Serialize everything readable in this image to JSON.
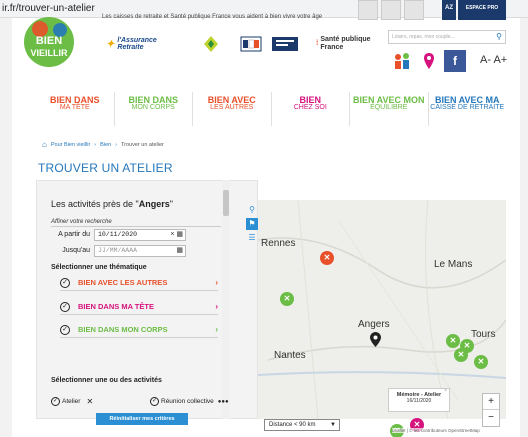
{
  "url": "ir.fr/trouver-un-atelier",
  "header": {
    "tagline": "Les caisses de retraite et Santé publique France vous aident à bien vivre votre âge",
    "logo_lines": [
      "BIEN",
      "VIEILLIR"
    ],
    "partners": {
      "assurance_retraite": "l'Assurance Retraite",
      "spf": "Santé publique France"
    },
    "az_label": "AZ",
    "espace_pro": "ESPACE PRO",
    "search_placeholder": "Loisirs, repas, mon couple...",
    "font_size_label": "A- A+"
  },
  "nav": [
    {
      "top": "BIEN DANS",
      "bottom": "MA TÊTE",
      "color": "#e8502a"
    },
    {
      "top": "BIEN DANS",
      "bottom": "MON CORPS",
      "color": "#6cbd45"
    },
    {
      "top": "BIEN AVEC",
      "bottom": "LES AUTRES",
      "color": "#e8502a"
    },
    {
      "top": "BIEN",
      "bottom": "CHEZ SOI",
      "color": "#d6127d"
    },
    {
      "top": "BIEN AVEC MON",
      "bottom": "ÉQUILIBRE",
      "color": "#6cbd45"
    },
    {
      "top": "BIEN AVEC MA",
      "bottom": "CAISSE DE RETRAITE",
      "color": "#2577bb"
    }
  ],
  "breadcrumb": {
    "home": "Pour Bien vieillir",
    "level1": "Bien",
    "current": "Trouver un atelier"
  },
  "page_title": "TROUVER UN ATELIER",
  "panel": {
    "title_prefix": "Les activités près de \"",
    "title_city": "Angers",
    "title_suffix": "\"",
    "refine": "Affiner votre recherche",
    "from_label": "A partir du",
    "from_value": "10/11/2020",
    "to_label": "Jusqu'au",
    "to_placeholder": "JJ/MM/AAAA",
    "theme_title": "Sélectionner une thématique",
    "themes": [
      {
        "label": "BIEN AVEC LES AUTRES",
        "color": "#e8502a"
      },
      {
        "label": "BIEN DANS MA TÊTE",
        "color": "#d6127d"
      },
      {
        "label": "BIEN DANS MON CORPS",
        "color": "#6cbd45"
      }
    ],
    "activities_title": "Sélectionner une ou des activités",
    "activity_atelier": "Atelier",
    "activity_reunion": "Réunion collective",
    "reset_label": "Réinitialiser mes critères"
  },
  "map": {
    "cities": [
      "Rennes",
      "Le Mans",
      "Angers",
      "Nantes",
      "Tours"
    ],
    "popup_title": "Mémoire - Atelier",
    "popup_date": "16/11/2020",
    "distance_label": "Distance < 90 km",
    "zoom_in": "+",
    "zoom_out": "−",
    "attribution": "Leaflet | © les contributeurs OpenStreetMap"
  }
}
